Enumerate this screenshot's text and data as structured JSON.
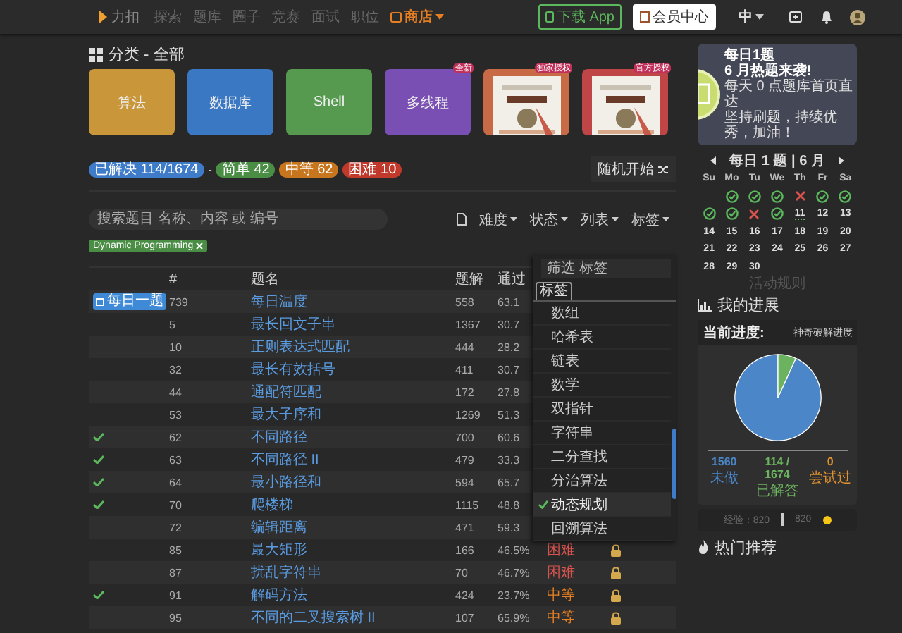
{
  "nav": {
    "logo": "力扣",
    "links": [
      "探索",
      "题库",
      "圈子",
      "竞赛",
      "面试",
      "职位"
    ],
    "store": "商店",
    "app_button": "下载 App",
    "vip_button": "会员中心",
    "language": "中"
  },
  "category": {
    "title": "分类 - 全部",
    "cards": [
      {
        "kind": "topic",
        "label": "算法",
        "color": "#c9973a"
      },
      {
        "kind": "topic",
        "label": "数据库",
        "color": "#3a78c4"
      },
      {
        "kind": "topic",
        "label": "Shell",
        "color": "#569a4f"
      },
      {
        "kind": "topic",
        "label": "多线程",
        "color": "#7a4fb4",
        "badge": "全新"
      },
      {
        "kind": "book",
        "color": "#c76a45",
        "badge": "独家授权"
      },
      {
        "kind": "book",
        "color": "#c04547",
        "badge": "官方授权"
      }
    ]
  },
  "stats": {
    "solved": "已解决 114/1674",
    "separator": "-",
    "easy": "简单 42",
    "medium": "中等 62",
    "hard": "困难 10",
    "random_button": "随机开始"
  },
  "filters": {
    "search": {
      "placeholder": "搜索题目 名称、内容 或 编号"
    },
    "dropdowns": [
      "难度",
      "状态",
      "列表",
      "标签"
    ],
    "active_tag": "Dynamic Programming"
  },
  "table": {
    "columns": [
      "#",
      "题名",
      "题解",
      "通过"
    ],
    "rows": [
      {
        "kind": "daily",
        "badge": "每日一题",
        "solved": false,
        "id": "739",
        "title": "每日温度",
        "solutions": "558",
        "pass": "63.1"
      },
      {
        "kind": "plain",
        "solved": false,
        "id": "5",
        "title": "最长回文子串",
        "solutions": "1367",
        "pass": "30.7"
      },
      {
        "kind": "plain",
        "solved": false,
        "id": "10",
        "title": "正则表达式匹配",
        "solutions": "444",
        "pass": "28.2"
      },
      {
        "kind": "plain",
        "solved": false,
        "id": "32",
        "title": "最长有效括号",
        "solutions": "411",
        "pass": "30.7"
      },
      {
        "kind": "plain",
        "solved": false,
        "id": "44",
        "title": "通配符匹配",
        "solutions": "172",
        "pass": "27.8"
      },
      {
        "kind": "plain",
        "solved": false,
        "id": "53",
        "title": "最大子序和",
        "solutions": "1269",
        "pass": "51.3"
      },
      {
        "kind": "plain",
        "solved": true,
        "id": "62",
        "title": "不同路径",
        "solutions": "700",
        "pass": "60.6"
      },
      {
        "kind": "plain",
        "solved": true,
        "id": "63",
        "title": "不同路径 II",
        "solutions": "479",
        "pass": "33.3"
      },
      {
        "kind": "plain",
        "solved": true,
        "id": "64",
        "title": "最小路径和",
        "solutions": "594",
        "pass": "65.7"
      },
      {
        "kind": "plain",
        "solved": true,
        "id": "70",
        "title": "爬楼梯",
        "solutions": "1115",
        "pass": "48.8"
      },
      {
        "kind": "plain",
        "solved": false,
        "id": "72",
        "title": "编辑距离",
        "solutions": "471",
        "pass": "59.3"
      },
      {
        "kind": "plain",
        "solved": false,
        "id": "85",
        "title": "最大矩形",
        "solutions": "166",
        "pass": "46.5%",
        "difficulty": "困难",
        "color": "#d9534f",
        "locked": true
      },
      {
        "kind": "plain",
        "solved": false,
        "id": "87",
        "title": "扰乱字符串",
        "solutions": "70",
        "pass": "46.7%",
        "difficulty": "困难",
        "color": "#d9534f",
        "locked": true
      },
      {
        "kind": "plain",
        "solved": true,
        "id": "91",
        "title": "解码方法",
        "solutions": "424",
        "pass": "23.7%",
        "difficulty": "中等",
        "color": "#e67e22",
        "locked": true
      },
      {
        "kind": "plain",
        "solved": false,
        "id": "95",
        "title": "不同的二叉搜索树 II",
        "solutions": "107",
        "pass": "65.9%",
        "difficulty": "中等",
        "color": "#e67e22",
        "locked": true
      }
    ]
  },
  "tag_menu": {
    "filter": {
      "placeholder": "筛选 标签"
    },
    "tab": "标签",
    "items": [
      {
        "label": "数组",
        "selected": false
      },
      {
        "label": "哈希表",
        "selected": false
      },
      {
        "label": "链表",
        "selected": false
      },
      {
        "label": "数学",
        "selected": false
      },
      {
        "label": "双指针",
        "selected": false
      },
      {
        "label": "字符串",
        "selected": false
      },
      {
        "label": "二分查找",
        "selected": false
      },
      {
        "label": "分治算法",
        "selected": false
      },
      {
        "label": "动态规划",
        "selected": true
      },
      {
        "label": "回溯算法",
        "selected": false
      }
    ]
  },
  "banner": {
    "title": "每日1题",
    "subtitle": "6 月热题来袭!",
    "lines": [
      "每天 0 点题库首页直达",
      "坚持刷题，持续优秀，加油！"
    ]
  },
  "calendar": {
    "title": "每日 1 题 | 6 月",
    "weekdays": [
      "Su",
      "Mo",
      "Tu",
      "We",
      "Th",
      "Fr",
      "Sa"
    ],
    "days": [
      {
        "kind": "blank"
      },
      {
        "kind": "done"
      },
      {
        "kind": "done"
      },
      {
        "kind": "done"
      },
      {
        "kind": "missed"
      },
      {
        "kind": "done"
      },
      {
        "kind": "done"
      },
      {
        "kind": "done"
      },
      {
        "kind": "done"
      },
      {
        "kind": "missed"
      },
      {
        "kind": "done"
      },
      {
        "kind": "today",
        "day": "11"
      },
      {
        "kind": "day",
        "day": "12"
      },
      {
        "kind": "day",
        "day": "13"
      },
      {
        "kind": "day",
        "day": "14"
      },
      {
        "kind": "day",
        "day": "15"
      },
      {
        "kind": "day",
        "day": "16"
      },
      {
        "kind": "day",
        "day": "17"
      },
      {
        "kind": "day",
        "day": "18"
      },
      {
        "kind": "day",
        "day": "19"
      },
      {
        "kind": "day",
        "day": "20"
      },
      {
        "kind": "day",
        "day": "21"
      },
      {
        "kind": "day",
        "day": "22"
      },
      {
        "kind": "day",
        "day": "23"
      },
      {
        "kind": "day",
        "day": "24"
      },
      {
        "kind": "day",
        "day": "25"
      },
      {
        "kind": "day",
        "day": "26"
      },
      {
        "kind": "day",
        "day": "27"
      },
      {
        "kind": "day",
        "day": "28"
      },
      {
        "kind": "day",
        "day": "29"
      },
      {
        "kind": "day",
        "day": "30"
      }
    ],
    "rules": "活动规则"
  },
  "progress": {
    "title": "我的进展",
    "current": "当前进度:",
    "mode": "神奇破解进度",
    "chart_data": {
      "type": "pie",
      "values": [
        93.2,
        6.8,
        0
      ]
    },
    "stats": [
      {
        "kind": "todo",
        "value": "1560",
        "label": "未做"
      },
      {
        "kind": "solved",
        "value": "114 / 1674",
        "label": "已解答"
      },
      {
        "kind": "tried",
        "value": "0",
        "label": "尝试过"
      }
    ],
    "experience": "经验：820",
    "coins": "820"
  },
  "hot": {
    "title": "热门推荐"
  }
}
